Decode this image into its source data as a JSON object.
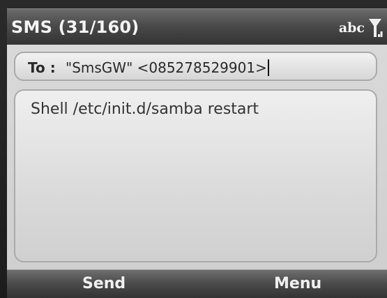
{
  "header": {
    "title": "SMS (31/160)",
    "input_mode": "abc",
    "signal_icon": "signal-antenna-icon"
  },
  "compose": {
    "to_label": "To :",
    "to_value": "\"SmsGW\" <085278529901>",
    "message": "Shell /etc/init.d/samba restart"
  },
  "softkeys": {
    "left": "Send",
    "right": "Menu"
  },
  "colors": {
    "titlebar": "#4a4a4a",
    "content_bg": "#d6d6d6",
    "text": "#2a2a2a"
  }
}
